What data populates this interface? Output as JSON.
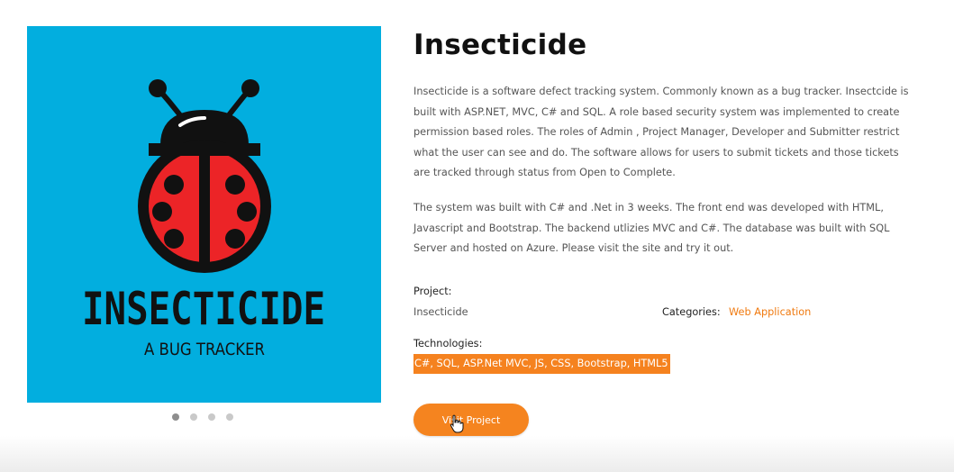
{
  "hero": {
    "bg_color": "#02aedf",
    "logo_title": "INSECTICIDE",
    "logo_subtitle": "A BUG TRACKER",
    "slide_count": 4,
    "active_slide": 1
  },
  "project": {
    "title": "Insecticide",
    "description_1": "Insecticide is a software defect tracking system. Commonly known as a bug tracker. Insectcide is built with ASP.NET, MVC, C# and SQL. A role based security system was implemented to create permission based roles. The roles of Admin , Project Manager, Developer and Submitter restrict what the user can see and do. The software allows for users to submit tickets and those tickets are tracked through status from Open to Complete.",
    "description_2": "The system was built with C# and .Net in 3 weeks. The front end was developed with HTML, Javascript and Bootstrap. The backend utlizies MVC and C#. The database was built with SQL Server and hosted on Azure. Please visit the site and try it out.",
    "project_label": "Project:",
    "project_value": "Insecticide",
    "categories_label": "Categories:",
    "categories_value": "Web Application",
    "technologies_label": "Technologies:",
    "technologies_value": "C#, SQL, ASP.Net MVC, JS, CSS, Bootstrap, HTML5",
    "visit_button": "Visit Project"
  },
  "colors": {
    "accent": "#f5821f",
    "link": "#f07a10",
    "ladybug_red": "#ec2427"
  },
  "icons": [
    "ladybug-logo-icon",
    "hand-cursor-icon"
  ]
}
